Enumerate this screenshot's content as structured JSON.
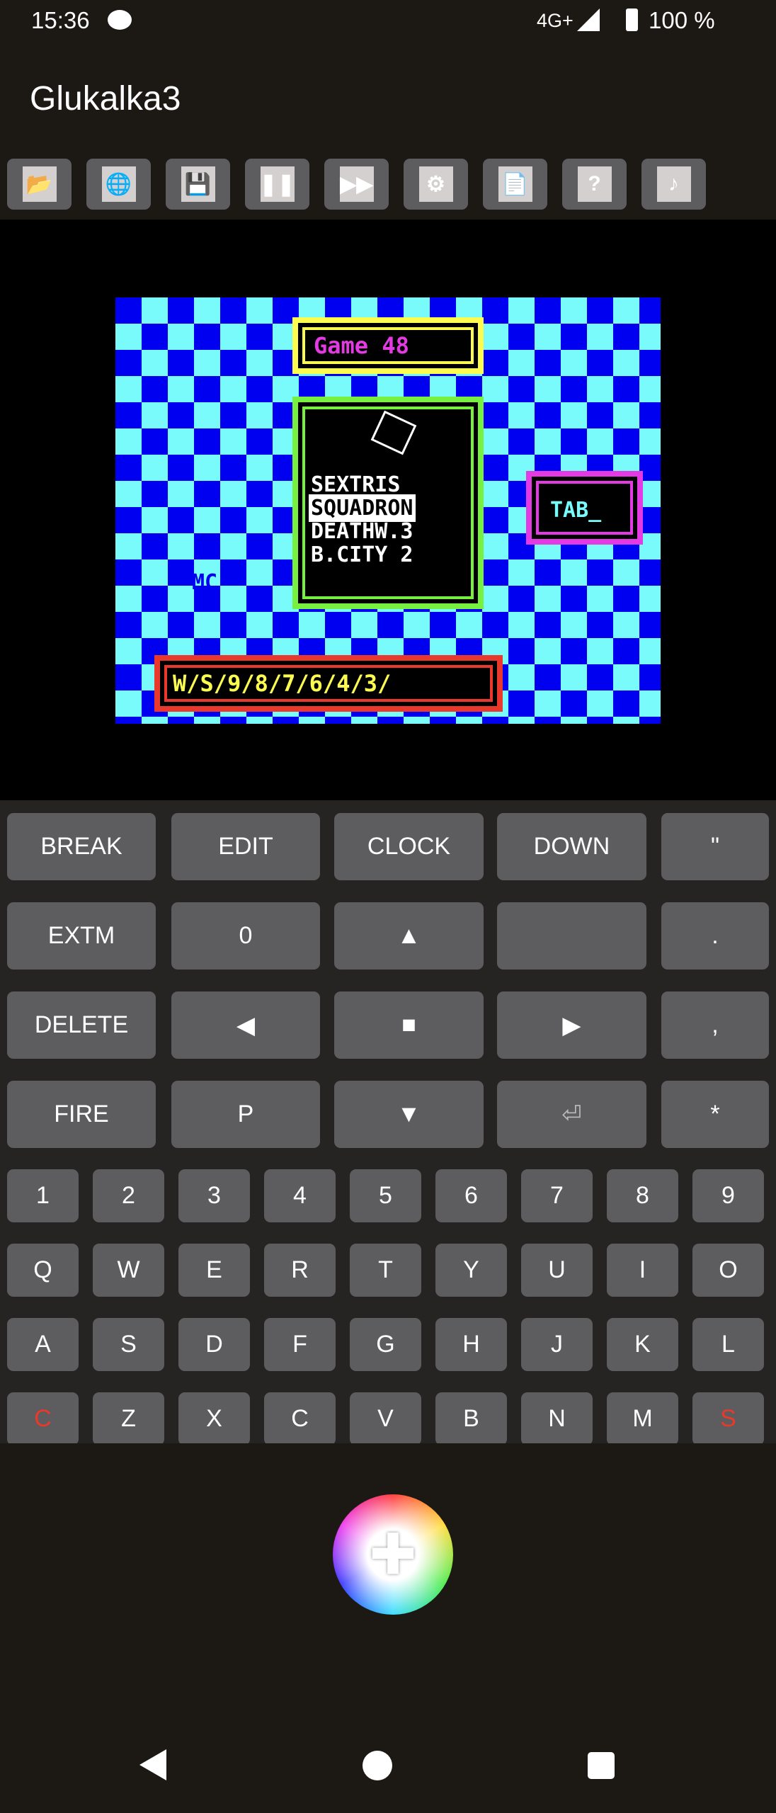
{
  "status": {
    "time": "15:36",
    "network": "4G+",
    "battery": "100 %"
  },
  "app": {
    "title": "Glukalka3"
  },
  "toolbar": [
    {
      "icon": "open-folder-icon",
      "glyph": "📂"
    },
    {
      "icon": "globe-search-icon",
      "glyph": "🌐"
    },
    {
      "icon": "floppy-save-icon",
      "glyph": "💾"
    },
    {
      "icon": "pause-icon",
      "glyph": "❚❚"
    },
    {
      "icon": "fast-forward-icon",
      "glyph": "▶▶"
    },
    {
      "icon": "settings-chip-icon",
      "glyph": "⚙"
    },
    {
      "icon": "document-edit-icon",
      "glyph": "📄"
    },
    {
      "icon": "help-icon",
      "glyph": "?"
    },
    {
      "icon": "music-file-icon",
      "glyph": "♪"
    }
  ],
  "game": {
    "title": "Game 48",
    "menu": [
      "SEXTRIS",
      "SQUADRON",
      "DEATHW.3",
      "B.CITY 2"
    ],
    "selected_index": 1,
    "tab_label": "TAB_",
    "logo": "MC",
    "levels": "W/S/9/8/7/6/4/3/",
    "colors": {
      "checker_light": "#78fbfa",
      "checker_dark": "#0000f0",
      "title_frame": "#fcfc50",
      "menu_frame": "#78f040",
      "tab_frame": "#e43ae4",
      "levels_frame": "#e8392c"
    }
  },
  "keyboard": {
    "big_rows": [
      [
        "BREAK",
        "EDIT",
        "CLOCK",
        "DOWN",
        "\""
      ],
      [
        "EXTM",
        "0",
        "▲",
        "",
        "."
      ],
      [
        "DELETE",
        "◀",
        "■",
        "▶",
        ","
      ],
      [
        "FIRE",
        "P",
        "▼",
        "⏎",
        "*"
      ]
    ],
    "small_rows": [
      [
        "1",
        "2",
        "3",
        "4",
        "5",
        "6",
        "7",
        "8",
        "9"
      ],
      [
        "Q",
        "W",
        "E",
        "R",
        "T",
        "Y",
        "U",
        "I",
        "O"
      ],
      [
        "A",
        "S",
        "D",
        "F",
        "G",
        "H",
        "J",
        "K",
        "L"
      ],
      [
        "C",
        "Z",
        "X",
        "C",
        "V",
        "B",
        "N",
        "M",
        "S"
      ]
    ],
    "red_keys": [
      "3.0",
      "3.8"
    ],
    "accent_red": "#e8392c"
  },
  "joystick": {
    "icon": "dpad-icon",
    "glyph": "✚"
  }
}
